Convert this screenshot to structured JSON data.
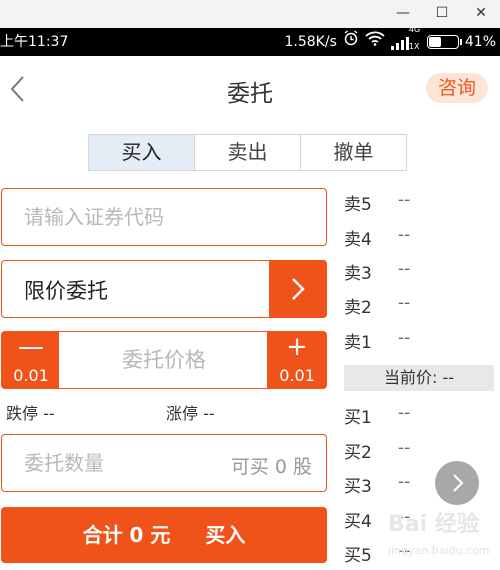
{
  "window": {
    "minimize": "—",
    "maximize": "☐",
    "close": "✕"
  },
  "status": {
    "time": "上午11:37",
    "speed": "1.58K/s",
    "network": "4G",
    "network_sub": "1X",
    "battery": "41%",
    "battery_level": 0.41
  },
  "header": {
    "title": "委托",
    "consult": "咨询"
  },
  "tabs": [
    {
      "label": "买入",
      "active": true
    },
    {
      "label": "卖出",
      "active": false
    },
    {
      "label": "撤单",
      "active": false
    }
  ],
  "form": {
    "code_placeholder": "请输入证券代码",
    "order_type": "限价委托",
    "price_placeholder": "委托价格",
    "minus_symbol": "—",
    "plus_symbol": "+",
    "price_step_minus": "0.01",
    "price_step_plus": "0.01",
    "limit_down": "跌停 --",
    "limit_up": "涨停 --",
    "qty_placeholder": "委托数量",
    "qty_available": "可买 0 股",
    "total": "合计 0 元",
    "submit": "买入"
  },
  "orderbook": {
    "sell": [
      {
        "label": "卖5",
        "value": "--"
      },
      {
        "label": "卖4",
        "value": "--"
      },
      {
        "label": "卖3",
        "value": "--"
      },
      {
        "label": "卖2",
        "value": "--"
      },
      {
        "label": "卖1",
        "value": "--"
      }
    ],
    "current_price": "当前价: --",
    "buy": [
      {
        "label": "买1",
        "value": "--"
      },
      {
        "label": "买2",
        "value": "--"
      },
      {
        "label": "买3",
        "value": "--"
      },
      {
        "label": "买4",
        "value": "--"
      },
      {
        "label": "买5",
        "value": "--"
      }
    ]
  },
  "watermark": {
    "text": "Bai 经验",
    "sub": "jingyan.baidu.com"
  },
  "colors": {
    "accent": "#f0531a",
    "tab_active": "#e4ecf6",
    "consult_bg": "#fde4d6"
  }
}
